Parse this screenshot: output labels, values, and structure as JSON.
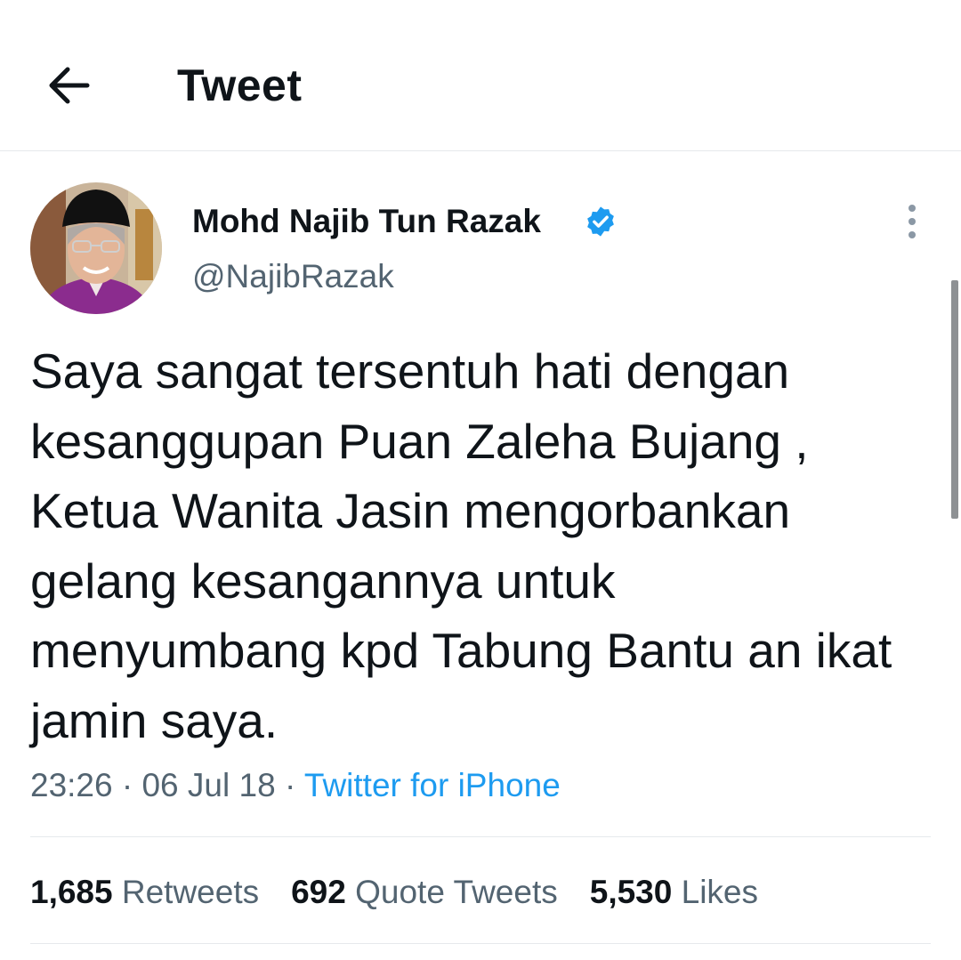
{
  "header": {
    "back_icon": "arrow-left-icon",
    "title": "Tweet"
  },
  "tweet": {
    "author": {
      "display_name": "Mohd Najib Tun Razak",
      "handle": "@NajibRazak",
      "verified": true,
      "verified_color": "#1d9bf0"
    },
    "more_icon": "more-vertical-icon",
    "text": "Saya sangat tersentuh hati dengan kesanggupan Puan Zaleha Bujang , Ketua Wanita Jasin mengorbankan gelang kesangannya untuk menyumbang kpd Tabung Bantu an ikat jamin saya.",
    "time": "23:26",
    "separator": "·",
    "date": "06 Jul 18",
    "source": "Twitter for iPhone",
    "source_color": "#1d9bf0"
  },
  "stats": {
    "retweets_count": "1,685",
    "retweets_label": "Retweets",
    "quotes_count": "692",
    "quotes_label": "Quote Tweets",
    "likes_count": "5,530",
    "likes_label": "Likes"
  }
}
